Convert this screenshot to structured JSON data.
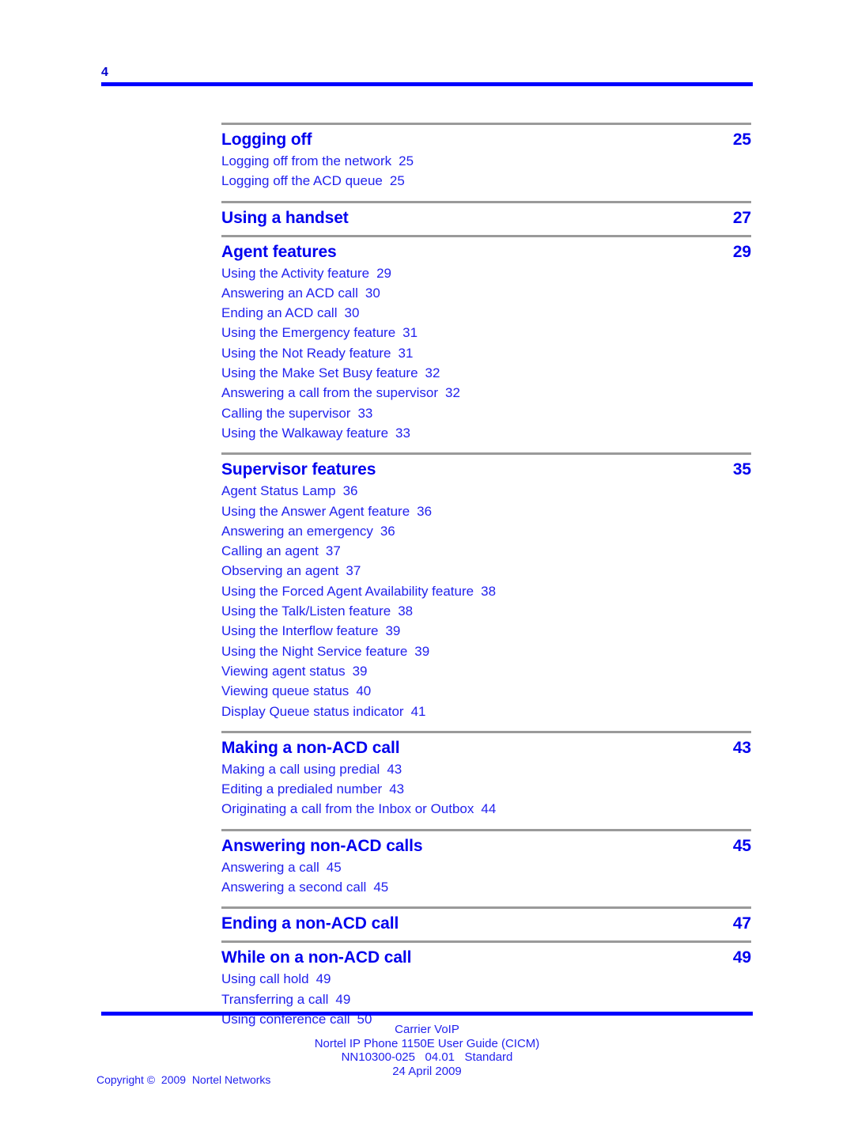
{
  "header": {
    "folio": "4"
  },
  "toc": {
    "sections": [
      {
        "title": "Logging off",
        "page": "25",
        "entries": [
          {
            "label": "Logging off from the network",
            "page": "25"
          },
          {
            "label": "Logging off the ACD queue",
            "page": "25"
          }
        ]
      },
      {
        "title": "Using a handset",
        "page": "27",
        "entries": []
      },
      {
        "title": "Agent features",
        "page": "29",
        "entries": [
          {
            "label": "Using the Activity feature",
            "page": "29"
          },
          {
            "label": "Answering an ACD call",
            "page": "30"
          },
          {
            "label": "Ending an ACD call",
            "page": "30"
          },
          {
            "label": "Using the Emergency feature",
            "page": "31"
          },
          {
            "label": "Using the Not Ready feature",
            "page": "31"
          },
          {
            "label": "Using the Make Set Busy feature",
            "page": "32"
          },
          {
            "label": "Answering a call from the supervisor",
            "page": "32"
          },
          {
            "label": "Calling the supervisor",
            "page": "33"
          },
          {
            "label": "Using the Walkaway feature",
            "page": "33"
          }
        ]
      },
      {
        "title": "Supervisor features",
        "page": "35",
        "entries": [
          {
            "label": "Agent Status Lamp",
            "page": "36"
          },
          {
            "label": "Using the Answer Agent feature",
            "page": "36"
          },
          {
            "label": "Answering an emergency",
            "page": "36"
          },
          {
            "label": "Calling an agent",
            "page": "37"
          },
          {
            "label": "Observing an agent",
            "page": "37"
          },
          {
            "label": "Using the Forced Agent Availability feature",
            "page": "38"
          },
          {
            "label": "Using the Talk/Listen feature",
            "page": "38"
          },
          {
            "label": "Using the Interflow feature",
            "page": "39"
          },
          {
            "label": "Using the Night Service feature",
            "page": "39"
          },
          {
            "label": "Viewing agent status",
            "page": "39"
          },
          {
            "label": "Viewing queue status",
            "page": "40"
          },
          {
            "label": "Display Queue status indicator",
            "page": "41"
          }
        ]
      },
      {
        "title": "Making a non-ACD call",
        "page": "43",
        "entries": [
          {
            "label": "Making a call using predial",
            "page": "43"
          },
          {
            "label": "Editing a predialed number",
            "page": "43"
          },
          {
            "label": "Originating a call from the Inbox or Outbox",
            "page": "44"
          }
        ]
      },
      {
        "title": "Answering non-ACD calls",
        "page": "45",
        "entries": [
          {
            "label": "Answering a call",
            "page": "45"
          },
          {
            "label": "Answering a second call",
            "page": "45"
          }
        ]
      },
      {
        "title": "Ending a non-ACD call",
        "page": "47",
        "entries": []
      },
      {
        "title": "While on a non-ACD call",
        "page": "49",
        "entries": [
          {
            "label": "Using call hold",
            "page": "49"
          },
          {
            "label": "Transferring a call",
            "page": "49"
          },
          {
            "label": "Using conference call",
            "page": "50"
          }
        ]
      }
    ]
  },
  "footer": {
    "lines": [
      "Carrier VoIP",
      "Nortel IP Phone 1150E User Guide (CICM)",
      "NN10300-025   04.01   Standard",
      "24 April 2009"
    ],
    "copyright": "Copyright ©  2009  Nortel Networks"
  },
  "colors": {
    "text_blue": "#0000ee",
    "rule_blue": "#0000ff",
    "rule_gray": "#9a9a9a"
  }
}
